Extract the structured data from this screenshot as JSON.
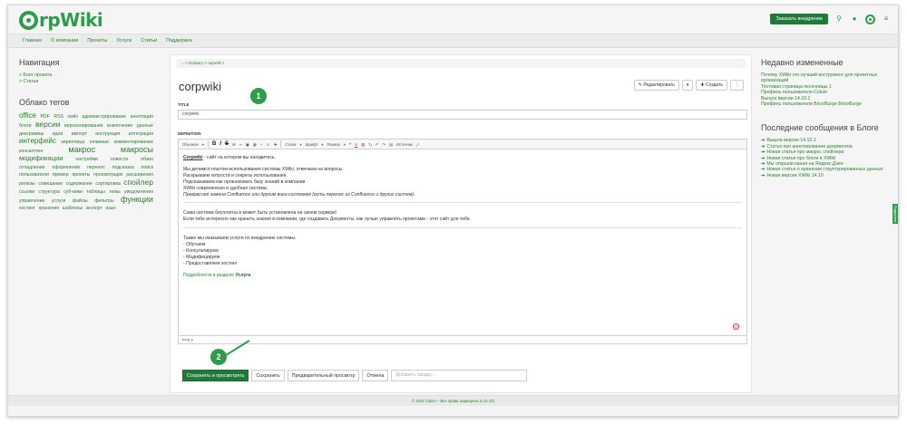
{
  "header": {
    "logo_text": "rpWiki",
    "cta_label": "Заказать внедрение",
    "colors": {
      "brand": "#2e9c4a",
      "brand_dark": "#1f7a3a"
    }
  },
  "menu": [
    "Главная",
    "О компании",
    "Проекты",
    "Услуги",
    "Статьи",
    "Поддержка"
  ],
  "left": {
    "nav_title": "Навигация",
    "nav_items": [
      "> Блог проекта",
      "> Статьи"
    ],
    "tags_title": "Облако тегов",
    "tags": [
      "office",
      "PDF",
      "RSS",
      "xwiki",
      "администрирование",
      "аннотации",
      "блоги",
      "версии",
      "версионирование",
      "вовлечение",
      "данные",
      "диаграммы",
      "идеи",
      "импорт",
      "инструкция",
      "интеграция",
      "интерфейс",
      "кириллица",
      "клавиши",
      "комментирование",
      "консалтинг",
      "макрос",
      "макросы",
      "модификации",
      "настройки",
      "новости",
      "обзин",
      "отладление",
      "оформление",
      "перенос",
      "подсказка",
      "поиск",
      "пользователи",
      "пример",
      "проекты",
      "просмотрщик",
      "расширения",
      "релизы",
      "совещание",
      "содержание",
      "сортировка",
      "спойлер",
      "ссылки",
      "структура",
      "суб-вики",
      "таблицы",
      "темы",
      "уведомления",
      "управление",
      "услуги",
      "файлы",
      "фильтры",
      "функции",
      "хостинг",
      "хранение",
      "шаблоны",
      "экспорт",
      "язык"
    ]
  },
  "main": {
    "breadcrumb": "⌂ > Glossary > corpwiki >",
    "title": "corpwiki",
    "edit_label": "✎ Редактировать",
    "edit_menu": "▾",
    "create_label": "✚ Создать",
    "more_label": "⋮",
    "title_field_label": "TITLE",
    "title_value": "corpwiki",
    "definition_label": "DEFINITION",
    "toolbar": {
      "style_select": "Обычное",
      "bold": "B",
      "italic": "I",
      "strike": "S",
      "styles": "Стили",
      "font": "Шрифт",
      "size": "Размер",
      "source": "Источник"
    },
    "content": {
      "p1_strong": "Corpwiki",
      "p1_rest": " - сайт на котором вы находитесь.",
      "p2": "Мы делимся опытом использования системы XWiki, отвечаем на вопросы.",
      "p3": "Раскрываем хитрости и секреты использования.",
      "p4": "Подсказываем как организовать базу знаний в компании.",
      "p5": "XWiki современная и удобная система.",
      "p6": "Прекрасная замена Confluence или другим вики-системам (есть перенос из Confluence и других систем).",
      "p7": "Сама система бесплатна и может быть установлена на своем сервере!",
      "p8": "Если тебе интересно как хранить знания в компании, где создавать Документы, как лучше управлять проектами - этот сайт для тебя.",
      "p9": "Также мы оказываем услуги по внедрению системы.",
      "p10": "- Обучаем",
      "p11": "- Консультируем",
      "p12": "- Модифицируем",
      "p13": "- Предоставляем хостинг",
      "p14_prefix": "Подробности в разделе ",
      "p14_link": "Услуги"
    },
    "status_path": "body p",
    "warning_count": "2",
    "callout_1": "1",
    "callout_2": "2"
  },
  "actions": {
    "save_view": "Сохранить и просмотреть",
    "save": "Сохранить",
    "preview": "Предварительный просмотр",
    "cancel": "Отмена",
    "summary_placeholder": "Добавить сводку..."
  },
  "right": {
    "recent_title": "Недавно измененные",
    "recent_items": [
      "Почему XWiki это лучший инструмент для проектных организаций",
      "Тестовая страница песочницы 1",
      "Профиль пользователя Colum",
      "Выпуск версии 14.10.1",
      "Профиль пользователя BriceBurge BriceBurge"
    ],
    "blog_title": "Последние сообщения в Блоге",
    "blog_items": [
      "Вышла версия 14.10.1",
      "Статья про аннотирование документов",
      "Новая статья про макрос спойлера",
      "Новая статья про блоги в XWiki",
      "Мы открыли канал на Яндекс.Дзен",
      "Новая статья о хранении структурированных данных",
      "Новая версия XWiki 14.10"
    ],
    "side_tab": "Поддержка"
  },
  "footer": "© 2022 Colum – Все права защищены (v.14.10)"
}
